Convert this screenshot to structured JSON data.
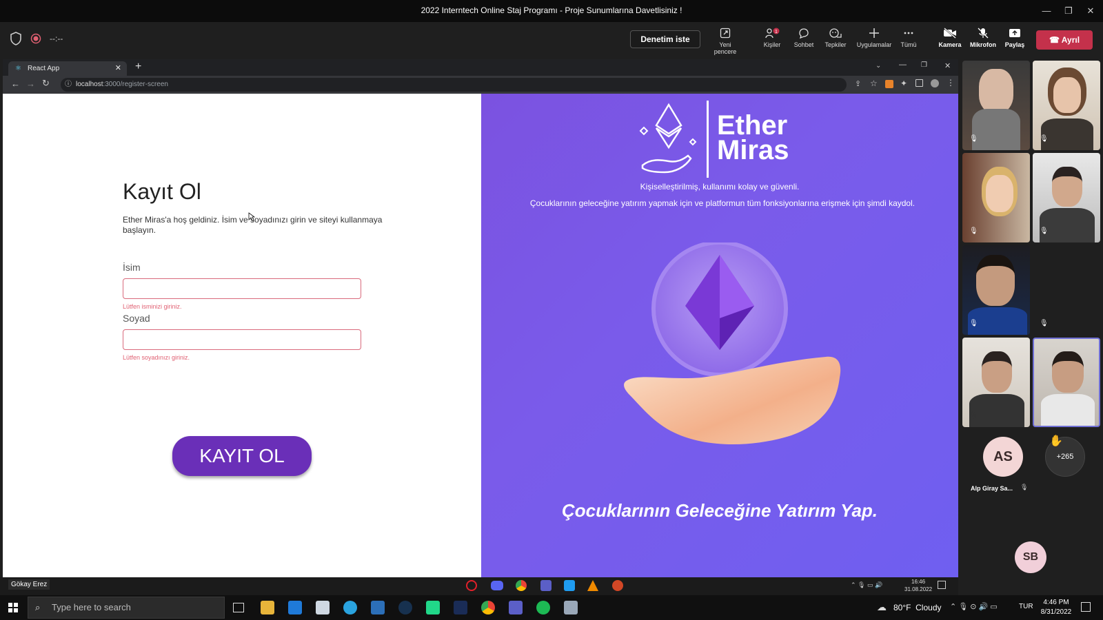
{
  "window": {
    "title": "2022 Interntech Online Staj Programı - Proje Sunumlarına Davetlisiniz !"
  },
  "meeting_toolbar": {
    "timer": "--:--",
    "request_control": "Denetim iste",
    "buttons": [
      {
        "label": "Yeni pencere",
        "icon": "new-window-icon"
      },
      {
        "label": "Kişiler",
        "icon": "people-icon",
        "badge": "1"
      },
      {
        "label": "Sohbet",
        "icon": "chat-icon"
      },
      {
        "label": "Tepkiler",
        "icon": "reactions-icon"
      },
      {
        "label": "Uygulamalar",
        "icon": "apps-icon"
      },
      {
        "label": "Tümü",
        "icon": "more-icon"
      },
      {
        "label": "Kamera",
        "icon": "camera-off-icon"
      },
      {
        "label": "Mikrofon",
        "icon": "mic-off-icon"
      },
      {
        "label": "Paylaş",
        "icon": "share-icon"
      }
    ],
    "leave": "Ayrıl"
  },
  "browser": {
    "tab_title": "React App",
    "url_host": "localhost",
    "url_path": ":3000/register-screen"
  },
  "register": {
    "heading": "Kayıt Ol",
    "intro": "Ether Miras'a hoş geldiniz. İsim ve soyadınızı girin ve siteyi kullanmaya başlayın.",
    "first_name_label": "İsim",
    "first_name_value": "",
    "first_name_error": "Lütfen isminizi giriniz.",
    "last_name_label": "Soyad",
    "last_name_value": "",
    "last_name_error": "Lütfen soyadınızı giriniz.",
    "submit": "KAYIT OL"
  },
  "hero": {
    "brand_line1": "Ether",
    "brand_line2": "Miras",
    "tagline": "Kişiselleştirilmiş, kullanımı kolay ve güvenli.",
    "description": "Çocuklarının geleceğine yatırım yapmak için ve platformun tüm fonksiyonlarına erişmek için şimdi kaydol.",
    "slogan": "Çocuklarının Geleceğine Yatırım Yap."
  },
  "presenter_taskbar": {
    "presenter_name": "Gökay Erez",
    "time": "16:46",
    "date": "31.08.2022"
  },
  "participants": {
    "avatar_initials": "AS",
    "avatar_name": "Alp Giray Sa...",
    "overflow_count": "+265",
    "avatar2_initials": "SB"
  },
  "taskbar": {
    "search_placeholder": "Type here to search",
    "weather": "80°F  Cloudy",
    "language": "TUR",
    "time": "4:46 PM",
    "date": "8/31/2022"
  },
  "colors": {
    "purple_bg": "#7b58e6",
    "submit_bg": "#6a2fb8",
    "error": "#e06072",
    "leave": "#c4314b"
  }
}
